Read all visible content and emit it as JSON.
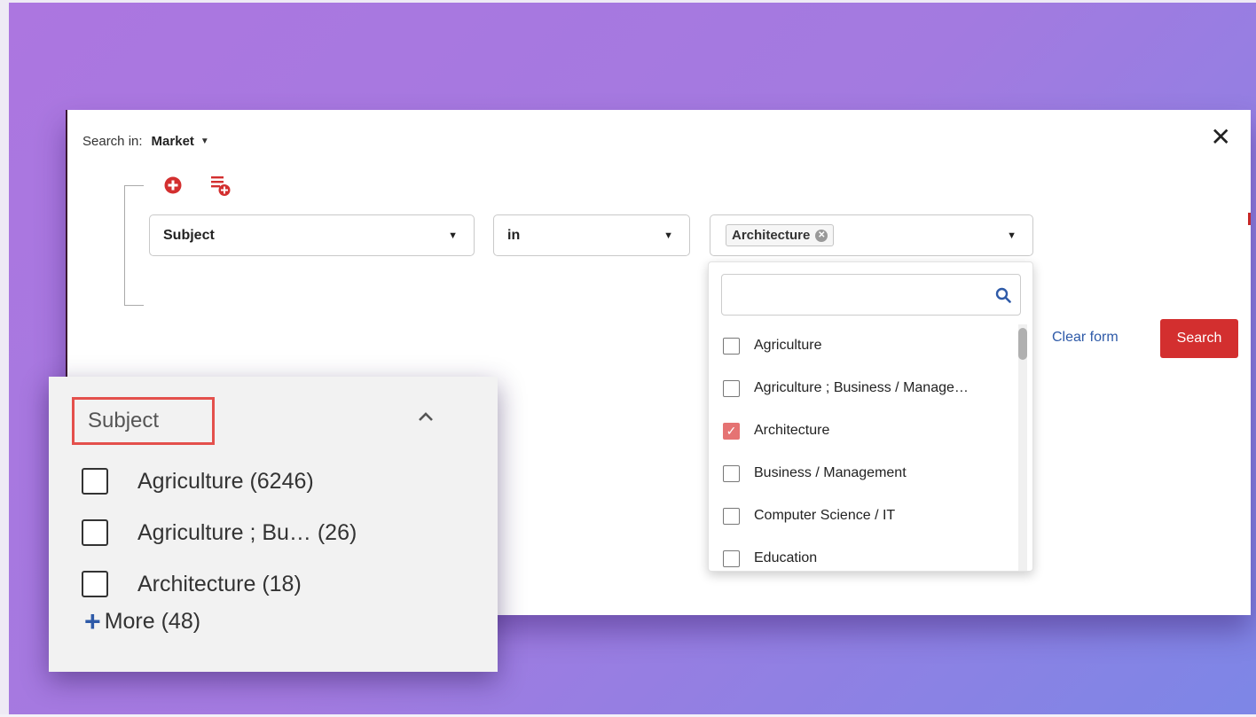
{
  "modal": {
    "search_in_label": "Search in:",
    "search_in_value": "Market",
    "close_label": "✕"
  },
  "query": {
    "field": "Subject",
    "operator": "in",
    "selected_chip": "Architecture"
  },
  "actions": {
    "clear_form": "Clear form",
    "search": "Search"
  },
  "dropdown": {
    "search_placeholder": "",
    "options": [
      {
        "label": "Agriculture",
        "checked": false
      },
      {
        "label": "Agriculture ; Business / Manage…",
        "checked": false
      },
      {
        "label": "Architecture",
        "checked": true
      },
      {
        "label": "Business / Management",
        "checked": false
      },
      {
        "label": "Computer Science / IT",
        "checked": false
      },
      {
        "label": "Education",
        "checked": false
      }
    ]
  },
  "facet": {
    "title": "Subject",
    "items": [
      {
        "label": "Agriculture (6246)"
      },
      {
        "label": "Agriculture ; Bu…  (26)"
      },
      {
        "label": "Architecture (18)"
      }
    ],
    "more": "More (48)"
  },
  "colors": {
    "accent_red": "#d32f2f",
    "link_blue": "#2e5aa8",
    "check_red": "#e57373",
    "highlight_box": "#e4504c"
  }
}
